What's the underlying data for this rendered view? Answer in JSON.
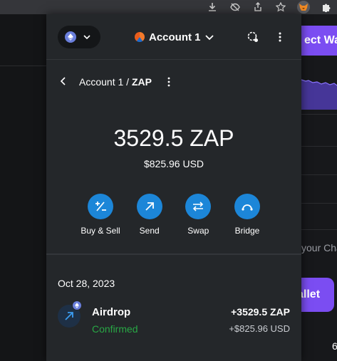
{
  "browser": {
    "icons": [
      "download-icon",
      "eye-off-icon",
      "share-icon",
      "star-icon",
      "fox-icon",
      "puzzle-icon"
    ]
  },
  "background_page": {
    "connect_button_label": "ect Wal",
    "partial_text": "your Cha",
    "wallet_button_label": "allet",
    "corner_mark": "6"
  },
  "header": {
    "account_name": "Account 1",
    "network_icon": "ethereum-icon"
  },
  "breadcrumb": {
    "account": "Account 1 /",
    "token": "ZAP"
  },
  "balance": {
    "amount": "3529.5 ZAP",
    "fiat": "$825.96 USD"
  },
  "actions": [
    {
      "label": "Buy & Sell",
      "icon": "plus-minus-icon"
    },
    {
      "label": "Send",
      "icon": "arrow-up-right-icon"
    },
    {
      "label": "Swap",
      "icon": "swap-arrows-icon"
    },
    {
      "label": "Bridge",
      "icon": "bridge-icon"
    }
  ],
  "activity": {
    "date": "Oct 28, 2023",
    "items": [
      {
        "title": "Airdrop",
        "status": "Confirmed",
        "amount": "+3529.5 ZAP",
        "fiat": "+$825.96 USD"
      }
    ]
  },
  "colors": {
    "popup_bg": "#24272a",
    "accent": "#1c86d8",
    "confirmed": "#28a745",
    "brand_purple": "#7b4df2"
  }
}
